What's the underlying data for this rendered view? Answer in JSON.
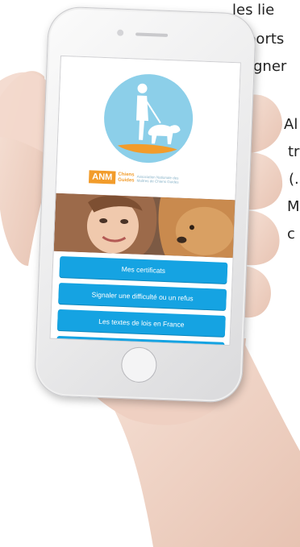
{
  "background_text": {
    "lines": [
      "les lie",
      "ports",
      "gner",
      "Al",
      "tr",
      "(.",
      "M",
      "c"
    ]
  },
  "app": {
    "brand": {
      "name": "ANM",
      "sub_line1": "Chiens",
      "sub_line2": "Guides",
      "tagline": "Association Nationale des Maîtres de Chiens Guides"
    },
    "menu": [
      {
        "label": "Mes certificats"
      },
      {
        "label": "Signaler une difficulté ou un refus"
      },
      {
        "label": "Les textes de lois en France"
      },
      {
        "label": ""
      }
    ]
  },
  "colors": {
    "accent": "#15a3e2",
    "logo_circle": "#8ccfe9",
    "brand_orange": "#f29c2b"
  },
  "icons": [
    "guide-dog-logo-icon",
    "home-button-icon"
  ]
}
